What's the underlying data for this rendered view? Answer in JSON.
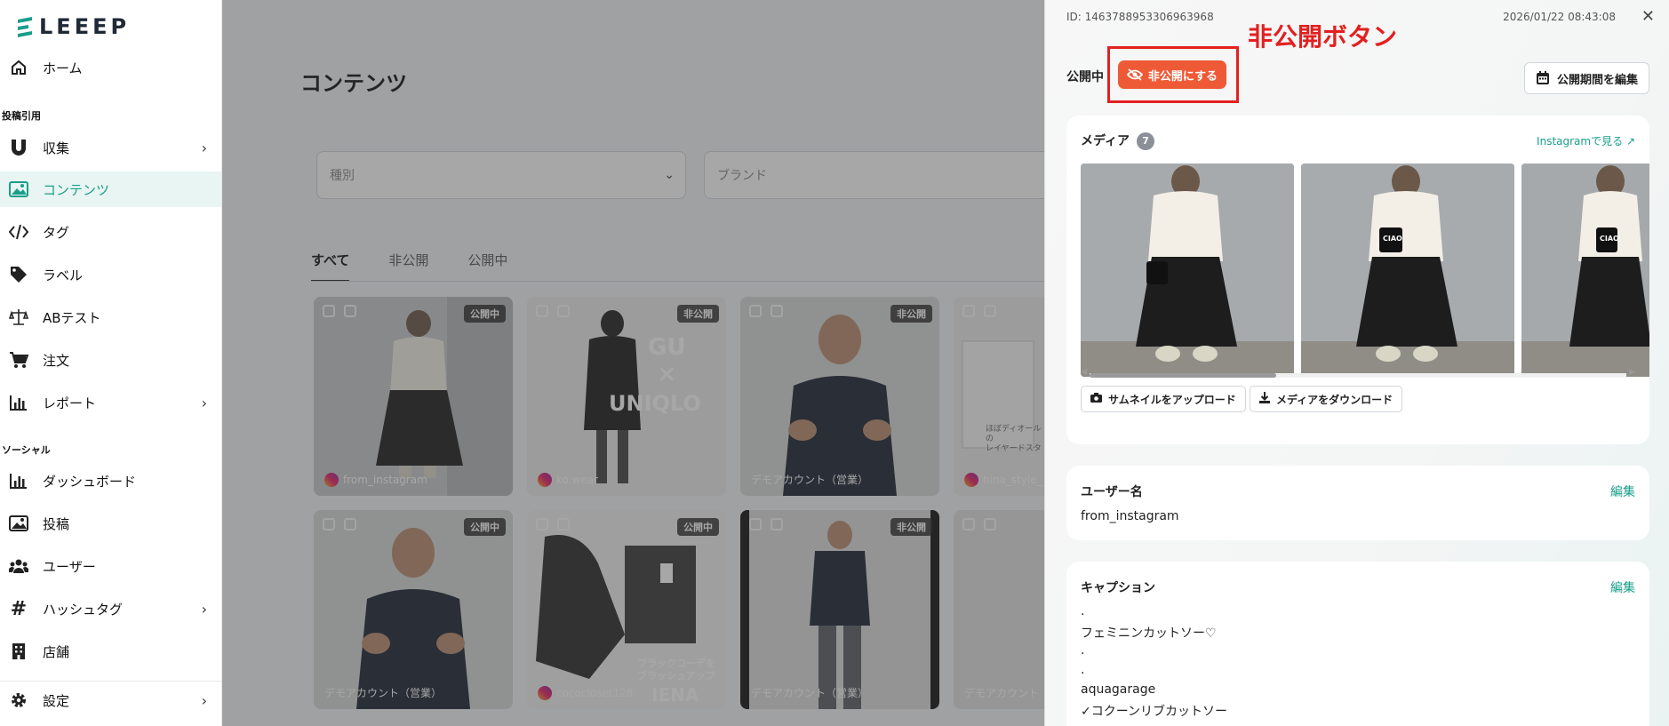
{
  "app": {
    "logo_text": "LEEEP",
    "brand_color": "#1a9e8a"
  },
  "sidebar": {
    "items": [
      {
        "label": "ホーム",
        "icon": "home-icon"
      },
      {
        "label": "収集",
        "icon": "magnet-icon"
      },
      {
        "label": "コンテンツ",
        "icon": "image-icon"
      },
      {
        "label": "タグ",
        "icon": "code-icon"
      },
      {
        "label": "ラベル",
        "icon": "tag-icon"
      },
      {
        "label": "ABテスト",
        "icon": "scale-icon"
      },
      {
        "label": "注文",
        "icon": "cart-icon"
      },
      {
        "label": "レポート",
        "icon": "bar-chart-icon"
      },
      {
        "label": "ダッシュボード",
        "icon": "bar-chart-icon"
      },
      {
        "label": "投稿",
        "icon": "image-icon"
      },
      {
        "label": "ユーザー",
        "icon": "users-icon"
      },
      {
        "label": "ハッシュタグ",
        "icon": "hashtag-icon"
      },
      {
        "label": "店舗",
        "icon": "building-icon"
      },
      {
        "label": "設定",
        "icon": "gear-icon"
      }
    ],
    "sections": {
      "posts": "投稿引用",
      "social": "ソーシャル"
    }
  },
  "main": {
    "title": "コンテンツ",
    "filters": {
      "type_placeholder": "種別",
      "brand_placeholder": "ブランド"
    },
    "tabs": [
      "すべて",
      "非公開",
      "公開中"
    ],
    "cards": [
      {
        "status": "公開中",
        "user": "from_instagram"
      },
      {
        "status": "非公開",
        "user": "ko.wear",
        "overlay_text": [
          "GU",
          "×",
          "UNIQLO"
        ]
      },
      {
        "status": "非公開",
        "user": "デモアカウント（営業）"
      },
      {
        "status": "",
        "user": "hina_style_",
        "overlay_text": [
          "ほぼディオールの",
          "レイヤードスタ"
        ]
      },
      {
        "status": "公開中",
        "user": "デモアカウント（営業）"
      },
      {
        "status": "公開中",
        "user": "cococloset128",
        "overlay_text": [
          "ブラックコーデを",
          "ブラッシュアップ",
          "IENA"
        ]
      },
      {
        "status": "非公開",
        "user": "デモアカウント（営業）"
      },
      {
        "status": "",
        "user": "デモアカウント"
      }
    ]
  },
  "panel": {
    "id_text": "ID: 1463788953306963968",
    "date": "2026/01/22 08:43:08",
    "status_label": "公開中",
    "unpublish_label": "非公開にする",
    "annotation": "非公開ボタン",
    "edit_period_label": "公開期間を編集",
    "media": {
      "title": "メディア",
      "count": "7",
      "ig_link": "Instagramで見る",
      "upload_thumb_label": "サムネイルをアップロード",
      "download_media_label": "メディアをダウンロード",
      "bag_text": "CIAO"
    },
    "username": {
      "title": "ユーザー名",
      "edit": "編集",
      "value": "from_instagram"
    },
    "caption": {
      "title": "キャプション",
      "edit": "編集",
      "lines": [
        ".",
        "フェミニンカットソー♡",
        ".",
        ".",
        "aquagarage",
        "✓コクーンリブカットソー"
      ]
    }
  }
}
